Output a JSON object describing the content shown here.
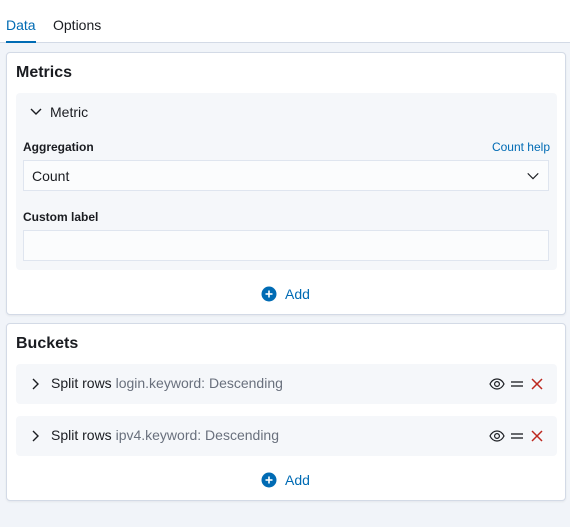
{
  "tabs": [
    {
      "label": "Data",
      "active": true
    },
    {
      "label": "Options",
      "active": false
    }
  ],
  "metrics": {
    "title": "Metrics",
    "aggregation": {
      "accordion_title": "Metric",
      "aggregation_label": "Aggregation",
      "help_link": "Count help",
      "selected_value": "Count",
      "custom_label_label": "Custom label",
      "custom_label_value": ""
    },
    "add_label": "Add"
  },
  "buckets": {
    "title": "Buckets",
    "rows": [
      {
        "type": "Split rows",
        "description": "login.keyword: Descending"
      },
      {
        "type": "Split rows",
        "description": "ipv4.keyword: Descending"
      }
    ],
    "add_label": "Add"
  },
  "colors": {
    "accent": "#006bb4",
    "danger": "#bd271e",
    "background": "#f1f4f9"
  },
  "icons": {
    "chevron_down": "chevron-down-icon",
    "chevron_right": "chevron-right-icon",
    "plus": "plus-in-circle-icon",
    "eye": "eye-icon",
    "drag": "drag-handle-icon",
    "remove": "cross-icon"
  }
}
